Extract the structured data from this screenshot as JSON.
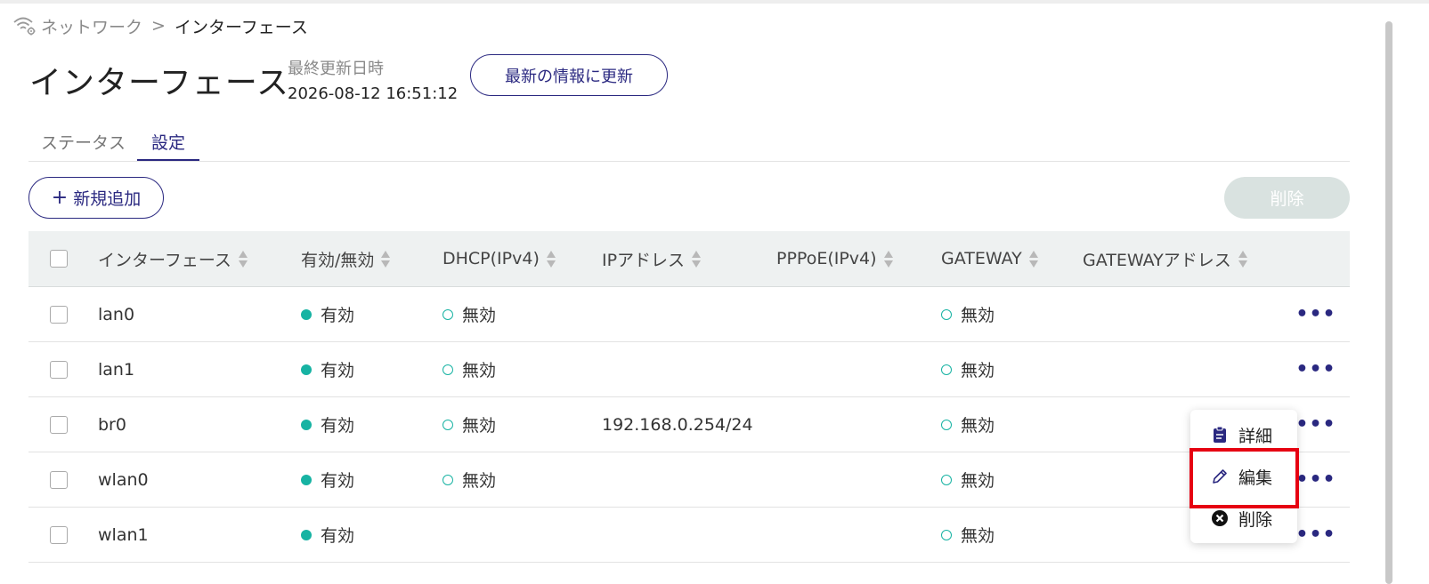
{
  "breadcrumb": {
    "parent": "ネットワーク",
    "separator": ">",
    "current": "インターフェース"
  },
  "page": {
    "title": "インターフェース",
    "last_updated_label": "最終更新日時",
    "last_updated_value": "2026-08-12 16:51:12",
    "refresh_label": "最新の情報に更新"
  },
  "tabs": [
    {
      "label": "ステータス",
      "active": false
    },
    {
      "label": "設定",
      "active": true
    }
  ],
  "toolbar": {
    "add_label": "新規追加",
    "delete_label": "削除"
  },
  "table": {
    "columns": [
      "インターフェース",
      "有効/無効",
      "DHCP(IPv4)",
      "IPアドレス",
      "PPPoE(IPv4)",
      "GATEWAY",
      "GATEWAYアドレス"
    ],
    "rows": [
      {
        "name": "lan0",
        "enabled": "有効",
        "dhcp": "無効",
        "ip": "",
        "pppoe": "",
        "gateway": "無効",
        "gateway_address": ""
      },
      {
        "name": "lan1",
        "enabled": "有効",
        "dhcp": "無効",
        "ip": "",
        "pppoe": "",
        "gateway": "無効",
        "gateway_address": ""
      },
      {
        "name": "br0",
        "enabled": "有効",
        "dhcp": "無効",
        "ip": "192.168.0.254/24",
        "pppoe": "",
        "gateway": "無効",
        "gateway_address": ""
      },
      {
        "name": "wlan0",
        "enabled": "有効",
        "dhcp": "無効",
        "ip": "",
        "pppoe": "",
        "gateway": "無効",
        "gateway_address": ""
      },
      {
        "name": "wlan1",
        "enabled": "有効",
        "dhcp": "",
        "ip": "",
        "pppoe": "",
        "gateway": "無効",
        "gateway_address": ""
      }
    ],
    "more_glyph": "•••"
  },
  "context_menu": {
    "items": [
      {
        "label": "詳細",
        "icon": "clipboard-icon"
      },
      {
        "label": "編集",
        "icon": "pencil-icon"
      },
      {
        "label": "削除",
        "icon": "close-circle-icon"
      }
    ],
    "highlighted": "編集"
  },
  "colors": {
    "accent": "#2a2880",
    "status_on": "#17b3a3",
    "header_bg": "#eef1f1",
    "highlight": "#e60012",
    "disabled_button": "#d9e2e0"
  }
}
